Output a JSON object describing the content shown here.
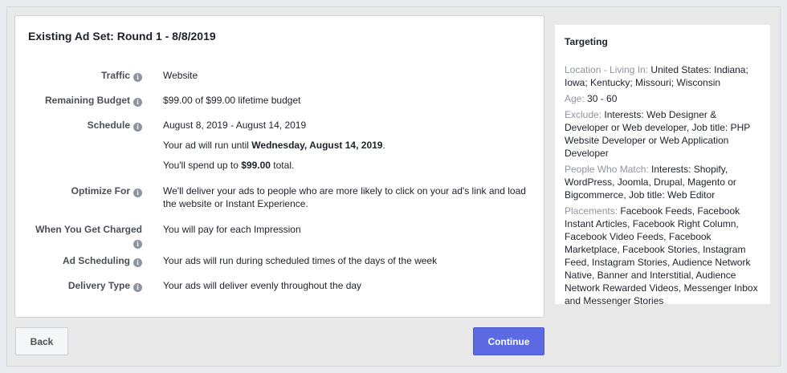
{
  "card": {
    "title": "Existing Ad Set: Round 1 - 8/8/2019",
    "rows": [
      {
        "label": "Traffic",
        "value": "Website"
      },
      {
        "label": "Remaining Budget",
        "value": "$99.00 of $99.00 lifetime budget"
      },
      {
        "label": "Schedule",
        "value": "August 8, 2019 - August 14, 2019",
        "line2_pre": "Your ad will run until ",
        "line2_bold": "Wednesday, August 14, 2019",
        "line2_post": ".",
        "line3_pre": "You'll spend up to ",
        "line3_bold": "$99.00",
        "line3_post": " total."
      },
      {
        "label": "Optimize For",
        "value": "We'll deliver your ads to people who are more likely to click on your ad's link and load the website or Instant Experience."
      },
      {
        "label": "When You Get Charged",
        "value": "You will pay for each Impression"
      },
      {
        "label": "Ad Scheduling",
        "value": "Your ads will run during scheduled times of the days of the week"
      },
      {
        "label": "Delivery Type",
        "value": "Your ads will deliver evenly throughout the day"
      }
    ],
    "info_glyph": "i"
  },
  "buttons": {
    "back": "Back",
    "continue": "Continue"
  },
  "targeting": {
    "title": "Targeting",
    "items": [
      {
        "key": "Location - Living In:",
        "value": " United States: Indiana; Iowa; Kentucky; Missouri; Wisconsin"
      },
      {
        "key": "Age:",
        "value": " 30 - 60"
      },
      {
        "key": "Exclude:",
        "value": " Interests: Web Designer & Developer or Web developer, Job title: PHP Website Developer or Web Application Developer"
      },
      {
        "key": "People Who Match:",
        "value": " Interests: Shopify, WordPress, Joomla, Drupal, Magento or Bigcommerce, Job title: Web Editor"
      },
      {
        "key": "Placements:",
        "value": " Facebook Feeds, Facebook Instant Articles, Facebook Right Column, Facebook Video Feeds, Facebook Marketplace, Facebook Stories, Instagram Feed, Instagram Stories, Audience Network Native, Banner and Interstitial, Audience Network Rewarded Videos, Messenger Inbox and Messenger Stories"
      }
    ]
  },
  "colors": {
    "accent": "#5b6ae2",
    "muted": "#90949c",
    "background": "#e9ebee"
  }
}
